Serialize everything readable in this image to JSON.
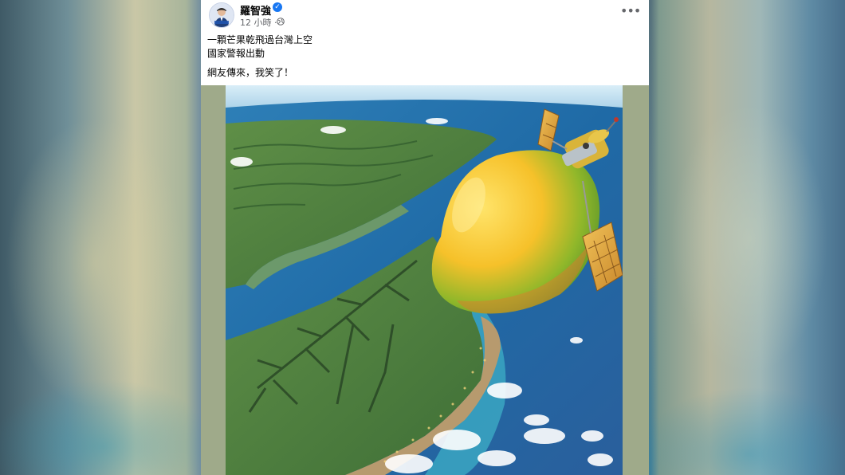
{
  "post": {
    "author": "羅智強",
    "time": "12 小時 ·",
    "lines": [
      "一顆芒果乾飛過台灣上空",
      "國家警報出動",
      "網友傳來，我笑了！"
    ]
  },
  "icons": {
    "verified": "verified-badge-icon",
    "privacy": "globe-icon",
    "more": "more-options-icon"
  },
  "colors": {
    "verified": "#1877f2",
    "text": "#050505",
    "meta": "#65676b"
  }
}
